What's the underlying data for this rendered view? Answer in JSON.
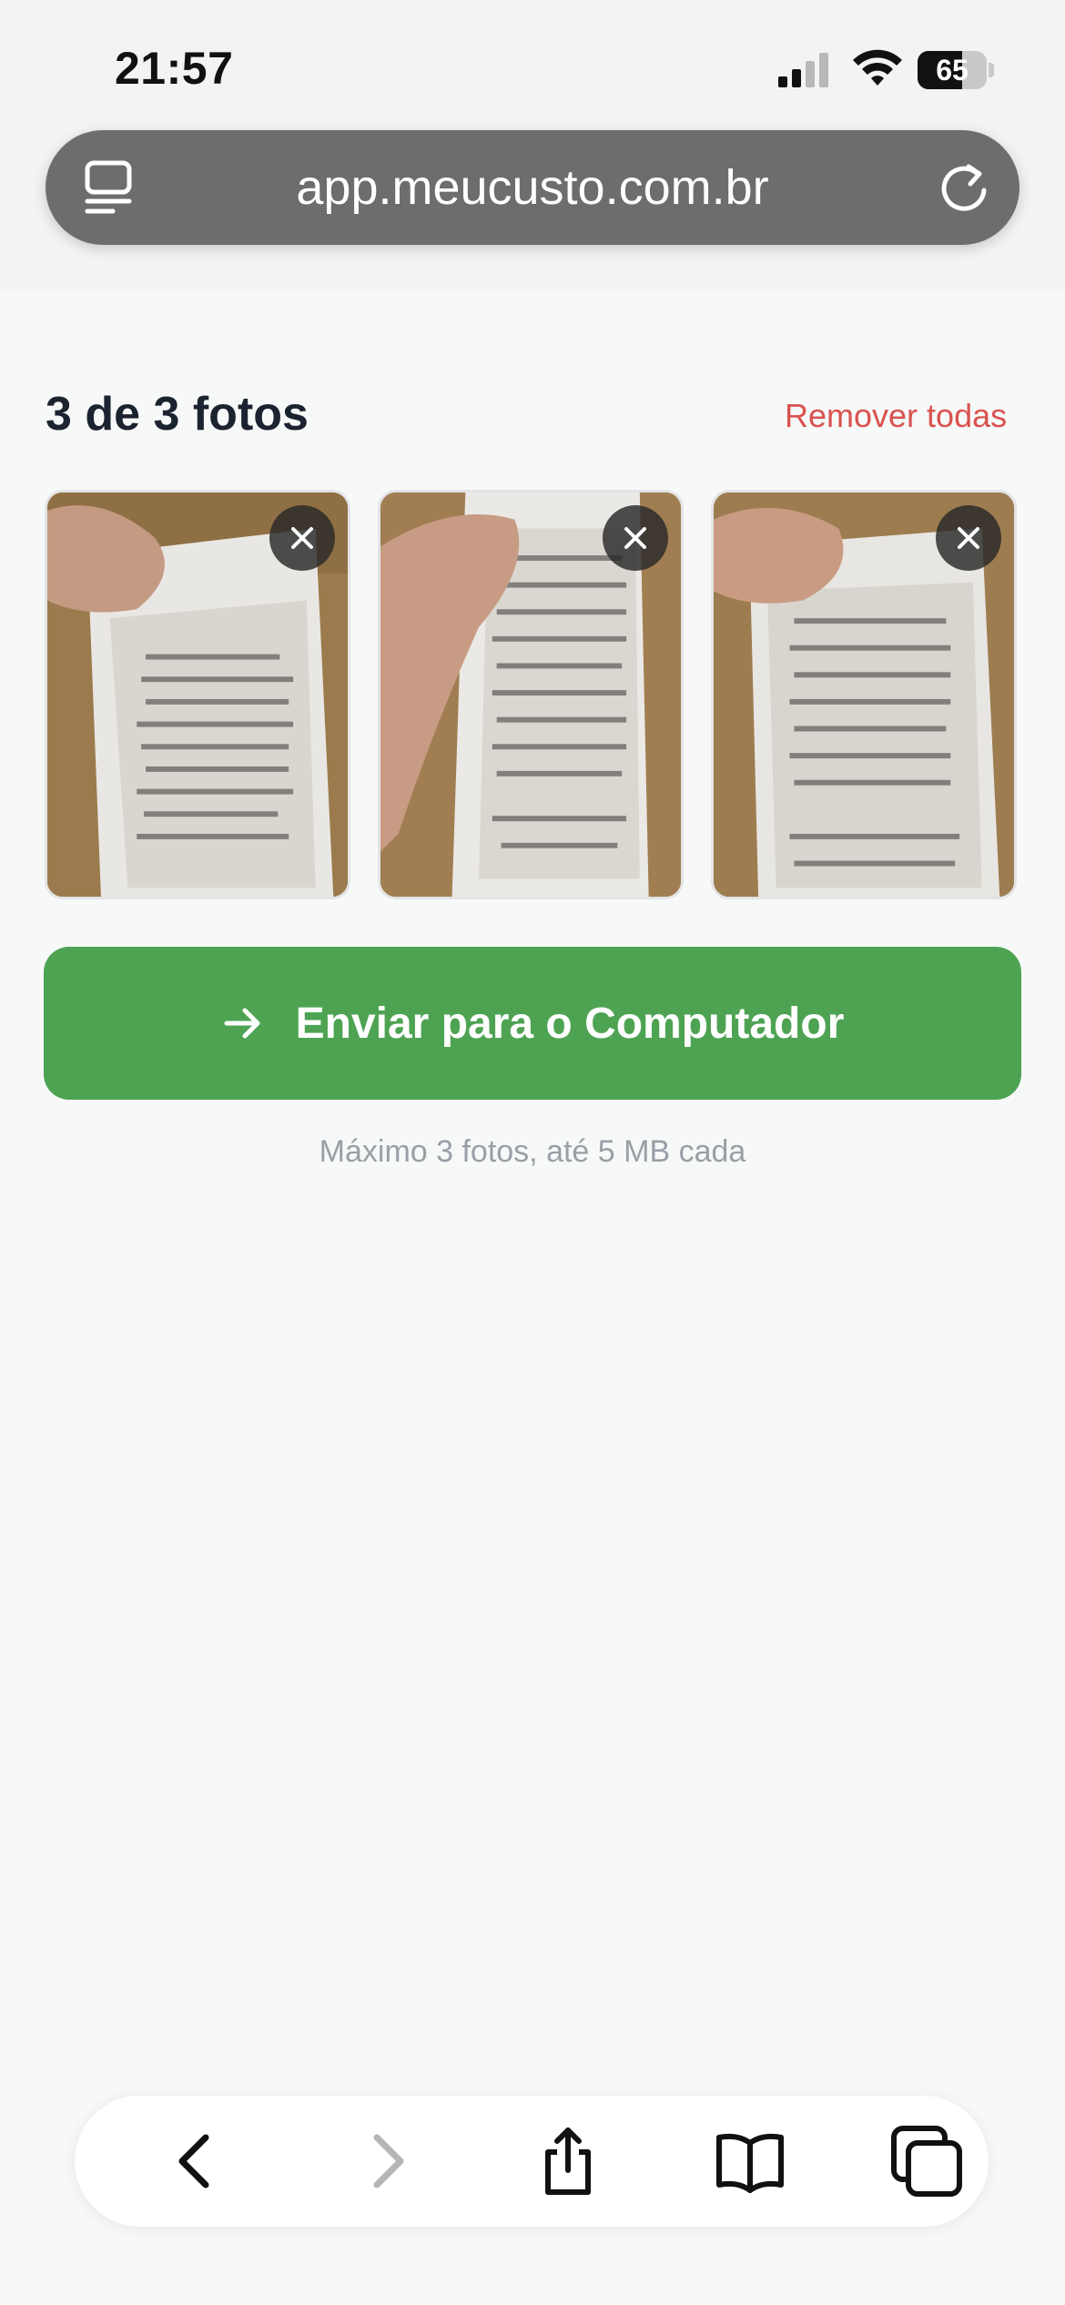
{
  "status_bar": {
    "time": "21:57",
    "battery_level": "65",
    "icons": [
      "cellular-signal-icon",
      "wifi-icon",
      "battery-icon"
    ]
  },
  "browser": {
    "url": "app.meucusto.com.br",
    "icons": [
      "tab-overview-icon",
      "reload-icon"
    ]
  },
  "upload": {
    "count_title": "3 de 3 fotos",
    "remove_all_label": "Remover todas",
    "photos": [
      {
        "remove_icon": "close-icon"
      },
      {
        "remove_icon": "close-icon"
      },
      {
        "remove_icon": "close-icon"
      }
    ],
    "send_button_label": "Enviar para o Computador",
    "send_icon": "arrow-right-icon",
    "hint": "Máximo 3 fotos, até 5 MB cada"
  },
  "toolbar": {
    "items": [
      "back-icon",
      "forward-icon",
      "share-icon",
      "bookmarks-icon",
      "tabs-icon"
    ]
  },
  "colors": {
    "accent_green": "#4ea353",
    "danger_red": "#d9534f",
    "title_text": "#1b2330"
  }
}
